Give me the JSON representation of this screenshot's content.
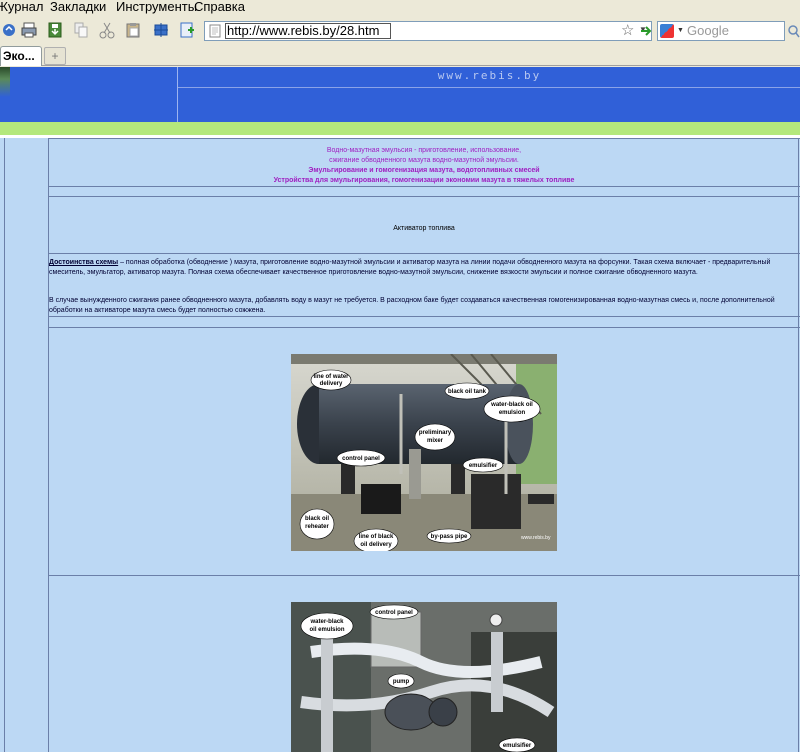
{
  "browser": {
    "menu": [
      "Журнал",
      "Закладки",
      "Инструменты",
      "Справка"
    ],
    "url": "http://www.rebis.by/28.htm",
    "search_placeholder": "Google",
    "tab_label": "Эко...",
    "new_tab": "+"
  },
  "site": {
    "header_title": "www.rebis.by",
    "intro_lines": [
      "Водно-мазутная эмульсия - приготовление, использование,",
      "сжигание обводненного мазута водно-мазутной эмульсии.",
      "Эмульгирование и гомогенизация мазута, водотопливных смесей",
      "Устройства для эмульгирования, гомогенизации экономии мазута в тяжелых топливе"
    ],
    "section_title": "Активатор топлива",
    "paragraph1_bold": "Достоинства схемы",
    "paragraph1": " – полная обработка (обводнение ) мазута, приготовление водно-мазутной эмульсии и активатор мазута на линии подачи обводненного мазута на форсунки. Такая схема включает - предварительный смеситель, эмульгатор, активатор мазута. Полная схема обеспечивает качественное приготовление водно-мазутной эмульсии, снижение вязкости эмульсии и полное сжигание обводненного мазута.",
    "paragraph2": "В случае вынужденного сжигания ранее обводненного мазута, добавлять воду в мазут не требуется. В расходном баке будет создаваться качественная гомогенизированная водно-мазутная смесь и, после дополнительной обработки на активаторе мазута смесь будет полностью сожжена.",
    "photo1_labels": [
      "line of water delivery",
      "black oil tank",
      "water-black oil emulsion",
      "preliminary mixer",
      "control panel",
      "emulsifier",
      "black oil reheater",
      "line of black oil delivery",
      "by-pass pipe"
    ],
    "photo2_labels": [
      "control panel",
      "water-black oil emulsion",
      "pump",
      "emulsifier"
    ]
  },
  "colors": {
    "header_blue": "#3060d8",
    "green_bar": "#b4e87c",
    "content_bg": "#bcd8f4",
    "intro_text": "#a020c0"
  }
}
